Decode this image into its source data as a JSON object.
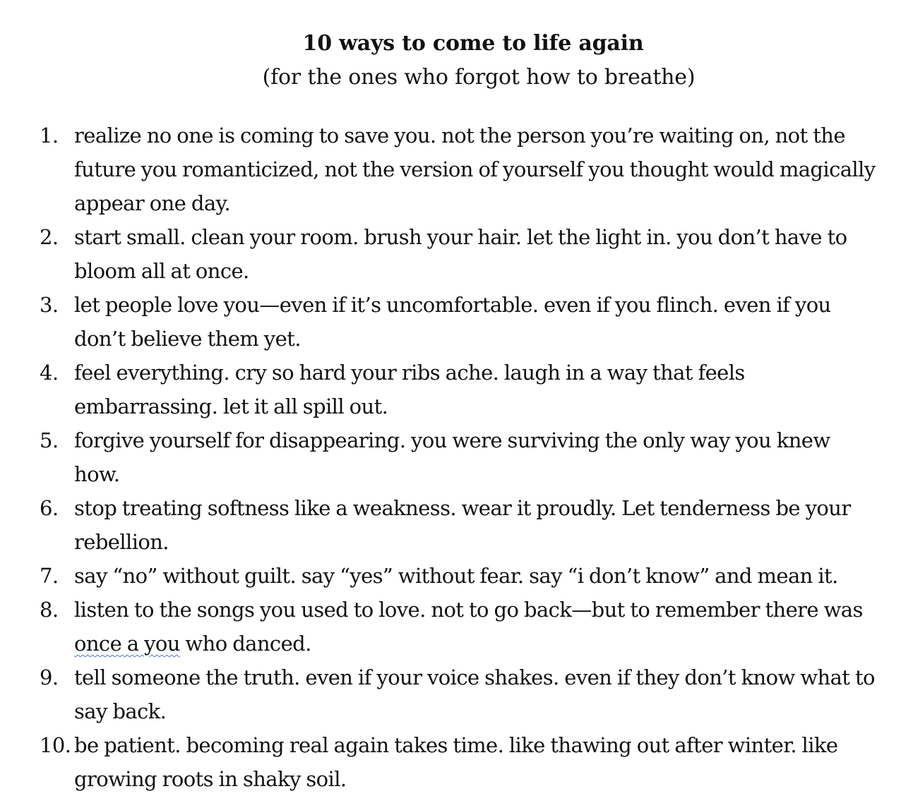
{
  "document": {
    "title": "10 ways to come to life again",
    "subtitle": "(for the ones who forgot how to breathe)",
    "items": [
      {
        "number": "1.",
        "text": "realize no one is coming to save you. not the person you’re waiting on, not the future you romanticized, not the version of yourself you thought would magically appear one day."
      },
      {
        "number": "2.",
        "text": "start small. clean your room. brush your hair. let the light in. you don’t have to bloom all at once."
      },
      {
        "number": "3.",
        "text": "let people love you—even if it’s uncomfortable. even if you flinch. even if you don’t believe them yet."
      },
      {
        "number": "4.",
        "text": "feel everything. cry so hard your ribs ache. laugh in a way that feels embarrassing. let it all spill out."
      },
      {
        "number": "5.",
        "text": "forgive yourself for disappearing. you were surviving the only way you knew how."
      },
      {
        "number": "6.",
        "text": "stop treating softness like a weakness. wear it proudly. Let tenderness be your rebellion."
      },
      {
        "number": "7.",
        "text": "say “no” without guilt. say “yes” without fear. say “i don’t know” and mean it."
      },
      {
        "number": "8.",
        "text_before": "listen to the songs you used to love. not to go back—but to remember there was ",
        "text_flagged": "once a you",
        "text_after": " who danced."
      },
      {
        "number": "9.",
        "text": "tell someone the truth. even if your voice shakes. even if they don’t know what to say back."
      },
      {
        "number": "10.",
        "text": "be patient. becoming real again takes time. like thawing out after winter. like growing roots in shaky soil."
      }
    ]
  },
  "colors": {
    "text": "#111111",
    "background": "#ffffff",
    "spellcheck_underline": "#4a78d6"
  }
}
